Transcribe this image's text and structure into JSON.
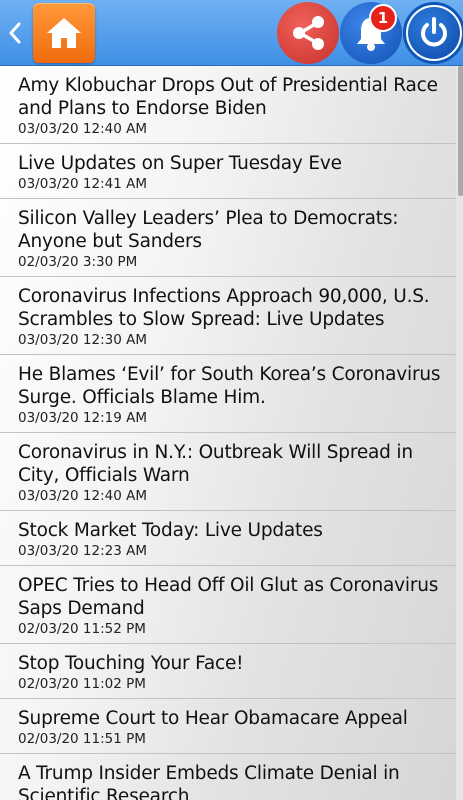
{
  "header": {
    "back_icon": "chevron-left-icon",
    "home_icon": "home-icon",
    "share_icon": "share-icon",
    "bell_icon": "bell-icon",
    "notification_count": "1",
    "power_icon": "power-icon",
    "colors": {
      "bar": "#4d9cec",
      "home_button": "#f47c18",
      "share_button": "#e0463f",
      "bell_button": "#1a5fc4",
      "power_button": "#0e56b8",
      "badge": "#e5231b"
    }
  },
  "articles": [
    {
      "title": "Amy Klobuchar Drops Out of Presidential Race and Plans to Endorse Biden",
      "time": "03/03/20 12:40 AM"
    },
    {
      "title": "Live Updates on Super Tuesday Eve",
      "time": "03/03/20 12:41 AM"
    },
    {
      "title": "Silicon Valley Leaders’ Plea to Democrats: Anyone but Sanders",
      "time": "02/03/20 3:30 PM"
    },
    {
      "title": "Coronavirus Infections Approach 90,000, U.S. Scrambles to Slow Spread: Live Updates",
      "time": "03/03/20 12:30 AM"
    },
    {
      "title": "He Blames ‘Evil’ for South Korea’s Coronavirus Surge. Officials Blame Him.",
      "time": "03/03/20 12:19 AM"
    },
    {
      "title": "Coronavirus in N.Y.: Outbreak Will Spread in City, Officials Warn",
      "time": "03/03/20 12:40 AM"
    },
    {
      "title": "Stock Market Today: Live Updates",
      "time": "03/03/20 12:23 AM"
    },
    {
      "title": "OPEC Tries to Head Off Oil Glut as Coronavirus Saps Demand",
      "time": "02/03/20 11:52 PM"
    },
    {
      "title": "Stop Touching Your Face!",
      "time": "02/03/20 11:02 PM"
    },
    {
      "title": "Supreme Court to Hear Obamacare Appeal",
      "time": "02/03/20 11:51 PM"
    },
    {
      "title": "A Trump Insider Embeds Climate Denial in Scientific Research",
      "time": ""
    }
  ]
}
